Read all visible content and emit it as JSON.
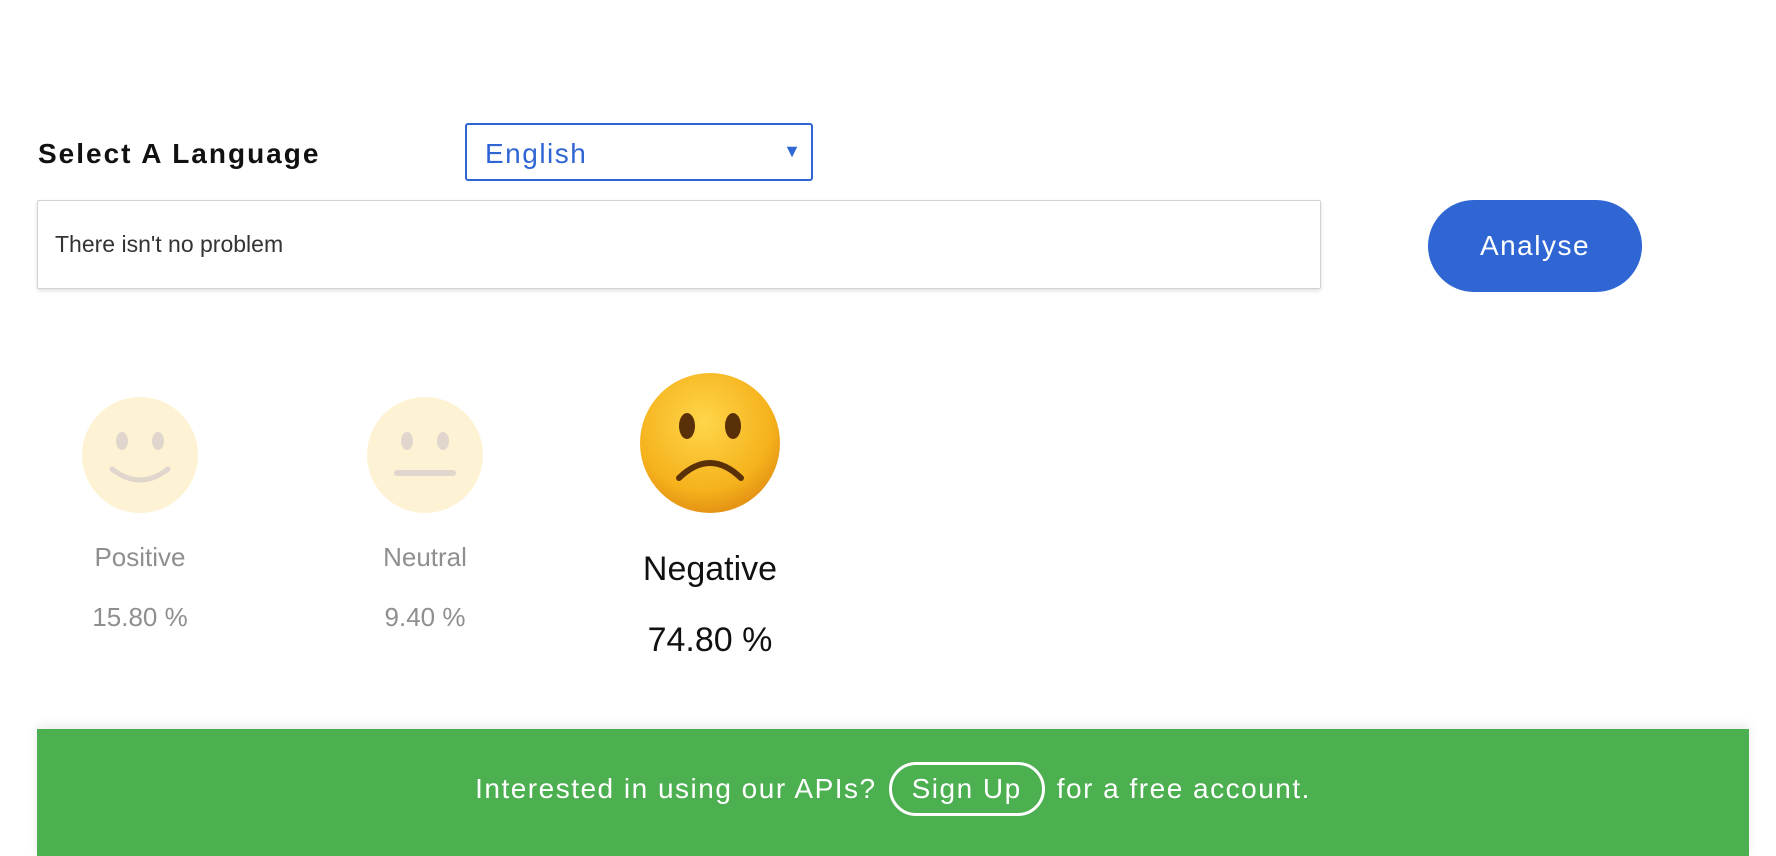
{
  "language": {
    "label": "Select A Language",
    "selected": "English"
  },
  "input": {
    "value": "There isn't no problem"
  },
  "analyse_button": {
    "label": "Analyse"
  },
  "sentiments": [
    {
      "name": "Positive",
      "percent": "15.80 %",
      "icon": "smiling-face-icon",
      "active": false
    },
    {
      "name": "Neutral",
      "percent": "9.40 %",
      "icon": "neutral-face-icon",
      "active": false
    },
    {
      "name": "Negative",
      "percent": "74.80 %",
      "icon": "frowning-face-icon",
      "active": true
    }
  ],
  "banner": {
    "text_before": "Interested in using our APIs?",
    "signup_label": "Sign Up",
    "text_after": "for a free account."
  },
  "colors": {
    "accent": "#2f66d4",
    "banner": "#4caf50",
    "emoji_yellow": "#f9c227"
  }
}
